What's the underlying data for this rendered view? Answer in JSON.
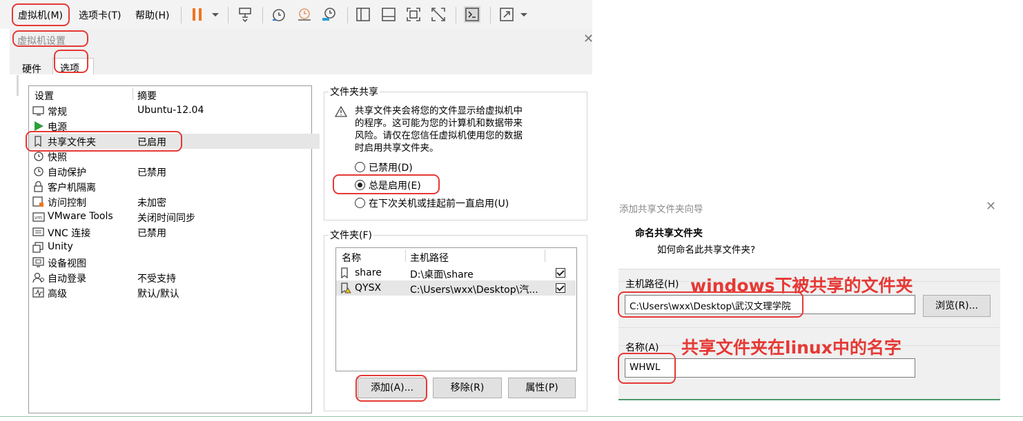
{
  "menubar": {
    "items": [
      "虚拟机(M)",
      "选项卡(T)",
      "帮助(H)"
    ],
    "toolbar_icons": [
      "pause-icon",
      "dropdown-arrow-icon",
      "network-send-icon",
      "snapshot-take-icon",
      "snapshot-revert-icon",
      "snapshot-manager-icon",
      "single-window-icon",
      "thumbnail-bar-icon",
      "fullscreen-icon",
      "unity-off-icon",
      "console-icon",
      "stretch-icon",
      "dropdown-arrow-icon"
    ]
  },
  "settings_dialog": {
    "title": "虚拟机设置",
    "tabs": [
      "硬件",
      "选项"
    ],
    "list_headers": [
      "设置",
      "摘要"
    ],
    "items": [
      {
        "name": "常规",
        "summary": "Ubuntu-12.04",
        "icon": "general-icon"
      },
      {
        "name": "电源",
        "summary": "",
        "icon": "power-icon"
      },
      {
        "name": "共享文件夹",
        "summary": "已启用",
        "icon": "shared-folder-icon"
      },
      {
        "name": "快照",
        "summary": "",
        "icon": "snapshot-icon"
      },
      {
        "name": "自动保护",
        "summary": "已禁用",
        "icon": "autoprotect-icon"
      },
      {
        "name": "客户机隔离",
        "summary": "",
        "icon": "isolation-icon"
      },
      {
        "name": "访问控制",
        "summary": "未加密",
        "icon": "access-control-icon"
      },
      {
        "name": "VMware Tools",
        "summary": "关闭时间同步",
        "icon": "vmware-tools-icon"
      },
      {
        "name": "VNC 连接",
        "summary": "已禁用",
        "icon": "vnc-icon"
      },
      {
        "name": "Unity",
        "summary": "",
        "icon": "unity-icon"
      },
      {
        "name": "设备视图",
        "summary": "",
        "icon": "device-view-icon"
      },
      {
        "name": "自动登录",
        "summary": "不受支持",
        "icon": "autologin-icon"
      },
      {
        "name": "高级",
        "summary": "默认/默认",
        "icon": "advanced-icon"
      }
    ],
    "folder_sharing": {
      "label": "文件夹共享",
      "warning_lines": [
        "共享文件夹会将您的文件显示给虚拟机中",
        "的程序。这可能为您的计算机和数据带来",
        "风险。请仅在您信任虚拟机使用您的数据",
        "时启用共享文件夹。"
      ],
      "options": [
        "已禁用(D)",
        "总是启用(E)",
        "在下次关机或挂起前一直启用(U)"
      ],
      "selected": "总是启用(E)"
    },
    "folders": {
      "label": "文件夹(F)",
      "headers": [
        "名称",
        "主机路径"
      ],
      "rows": [
        {
          "name": "share",
          "path": "D:\\桌面\\share",
          "checked": true
        },
        {
          "name": "QYSX",
          "path": "C:\\Users\\wxx\\Desktop\\汽...",
          "checked": true
        }
      ],
      "buttons": [
        "添加(A)...",
        "移除(R)",
        "属性(P)"
      ]
    }
  },
  "wizard": {
    "title": "添加共享文件夹向导",
    "heading": "命名共享文件夹",
    "subheading": "如何命名此共享文件夹?",
    "host_path_label": "主机路径(H)",
    "host_path_value": "C:\\Users\\wxx\\Desktop\\武汉文理学院",
    "browse_label": "浏览(R)...",
    "name_label": "名称(A)",
    "name_value": "WHWL"
  },
  "annotations": {
    "host_note": "windows下被共享的文件夹",
    "name_note": "共享文件夹在linux中的名字",
    "color": "#e53935"
  }
}
